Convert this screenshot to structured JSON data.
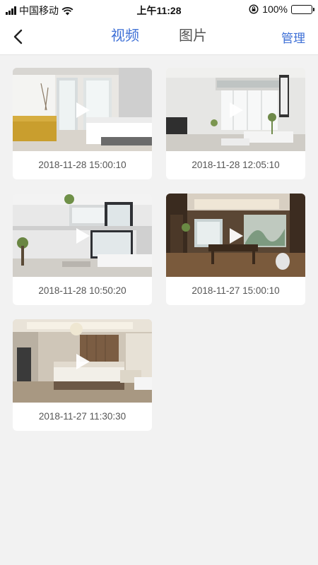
{
  "status_bar": {
    "carrier": "中国移动",
    "time": "上午11:28",
    "battery": "100%"
  },
  "nav": {
    "tabs": [
      {
        "label": "视频",
        "active": true
      },
      {
        "label": "图片",
        "active": false
      }
    ],
    "manage_label": "管理"
  },
  "videos": [
    {
      "timestamp": "2018-11-28 15:00:10",
      "scene": "bright bedroom"
    },
    {
      "timestamp": "2018-11-28 12:05:10",
      "scene": "white living room"
    },
    {
      "timestamp": "2018-11-28 10:50:20",
      "scene": "duplex living room"
    },
    {
      "timestamp": "2018-11-27 15:00:10",
      "scene": "chinese style living room"
    },
    {
      "timestamp": "2018-11-27 11:30:30",
      "scene": "master bedroom"
    }
  ],
  "colors": {
    "accent": "#3d6fd6",
    "background": "#f2f2f2",
    "card": "#ffffff"
  }
}
